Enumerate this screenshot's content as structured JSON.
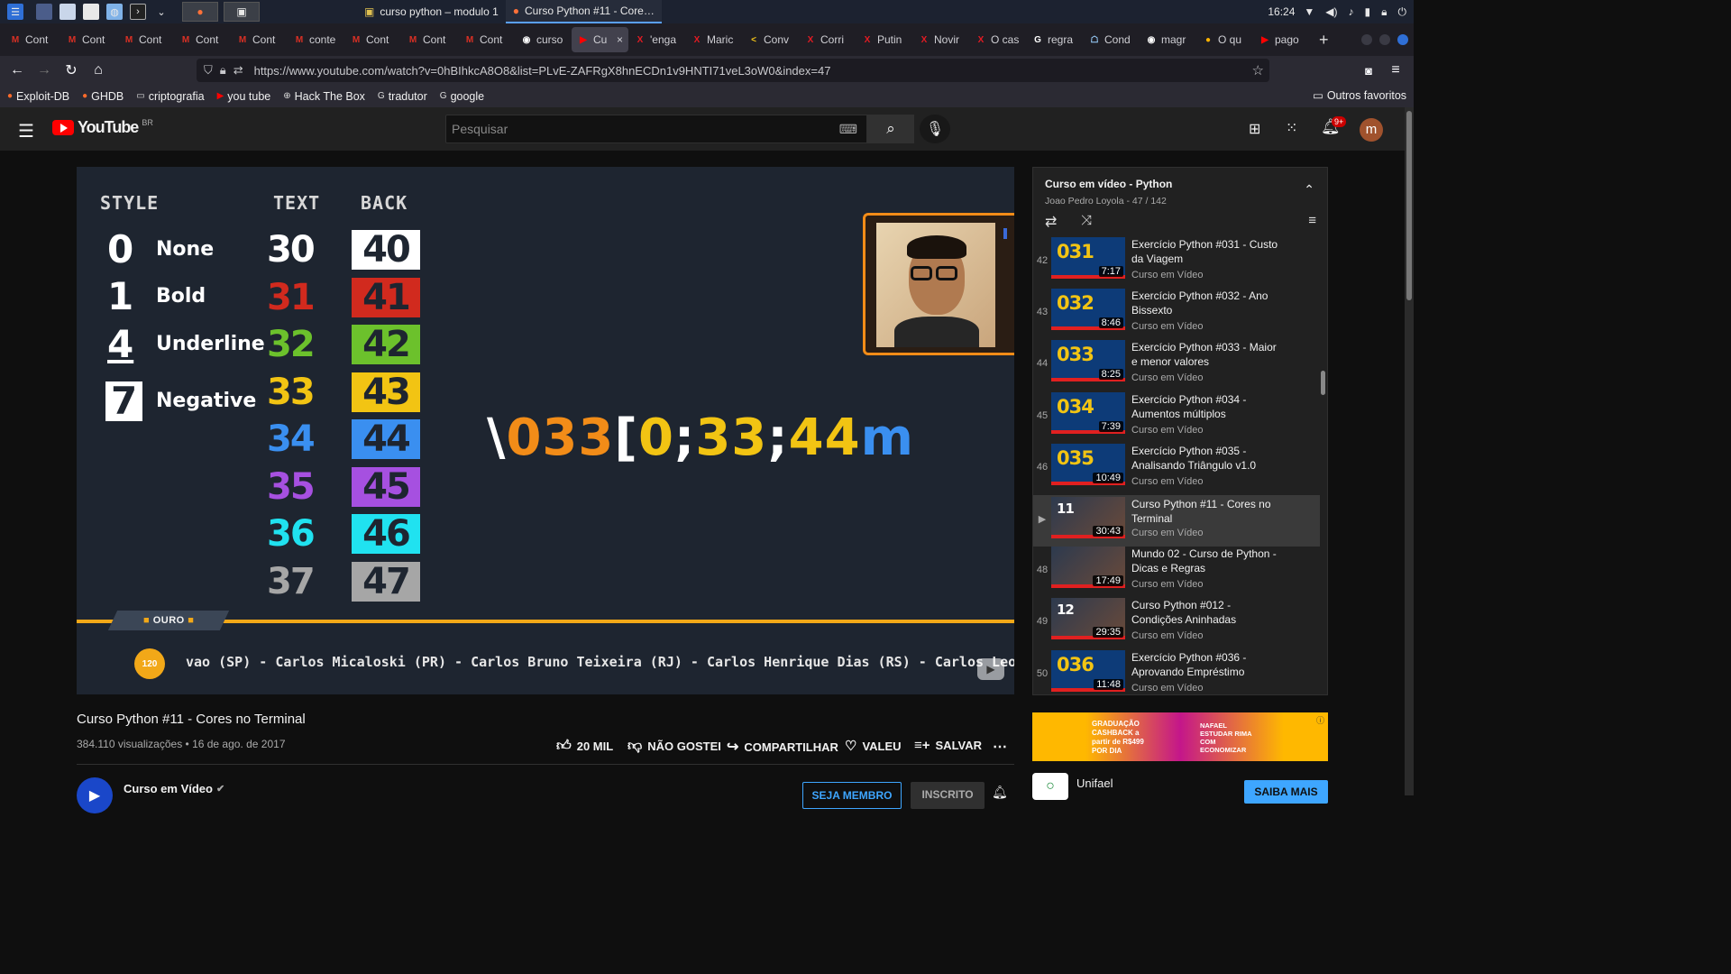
{
  "taskbar": {
    "windows": [
      "curso python – modulo 1",
      "Curso Python #11 - Core…"
    ],
    "time": "16:24"
  },
  "tabs": [
    {
      "label": "Cont",
      "fav": "M",
      "color": "#d93025"
    },
    {
      "label": "Cont",
      "fav": "M",
      "color": "#d93025"
    },
    {
      "label": "Cont",
      "fav": "M",
      "color": "#d93025"
    },
    {
      "label": "Cont",
      "fav": "M",
      "color": "#d93025"
    },
    {
      "label": "Cont",
      "fav": "M",
      "color": "#d93025"
    },
    {
      "label": "conte",
      "fav": "M",
      "color": "#d93025"
    },
    {
      "label": "Cont",
      "fav": "M",
      "color": "#d93025"
    },
    {
      "label": "Cont",
      "fav": "M",
      "color": "#d93025"
    },
    {
      "label": "Cont",
      "fav": "M",
      "color": "#d93025"
    },
    {
      "label": "curso",
      "fav": "◉",
      "color": "#ffffff"
    },
    {
      "label": "Cu",
      "fav": "▶",
      "color": "#ff0000",
      "active": true
    },
    {
      "label": "'enga",
      "fav": "X",
      "color": "#e31b23"
    },
    {
      "label": "Maric",
      "fav": "X",
      "color": "#e31b23"
    },
    {
      "label": "Conv",
      "fav": "<",
      "color": "#f5c518"
    },
    {
      "label": "Corri",
      "fav": "X",
      "color": "#e31b23"
    },
    {
      "label": "Putin",
      "fav": "X",
      "color": "#e31b23"
    },
    {
      "label": "Novir",
      "fav": "X",
      "color": "#e31b23"
    },
    {
      "label": "O cas",
      "fav": "X",
      "color": "#e31b23"
    },
    {
      "label": "regra",
      "fav": "G",
      "color": "#ffffff"
    },
    {
      "label": "Cond",
      "fav": "☖",
      "color": "#9ad0ff"
    },
    {
      "label": "magr",
      "fav": "◉",
      "color": "#ffffff"
    },
    {
      "label": "O qu",
      "fav": "●",
      "color": "#ffb300"
    },
    {
      "label": "pago",
      "fav": "▶",
      "color": "#ff0000"
    }
  ],
  "url": "https://www.youtube.com/watch?v=0hBIhkcA8O8&list=PLvE-ZAFRgX8hnECDn1v9HNTI71veL3oW0&index=47",
  "bookmarks": [
    {
      "label": "Exploit-DB",
      "icon": "●"
    },
    {
      "label": "GHDB",
      "icon": "●"
    },
    {
      "label": "criptografia",
      "icon": "▭"
    },
    {
      "label": "you tube",
      "icon": "▶"
    },
    {
      "label": "Hack The Box",
      "icon": "⊕"
    },
    {
      "label": "tradutor",
      "icon": "G"
    },
    {
      "label": "google",
      "icon": "G"
    }
  ],
  "bookmarks_other": "Outros favoritos",
  "youtube": {
    "logo": "YouTube",
    "region": "BR",
    "search_placeholder": "Pesquisar",
    "notifications": "9+",
    "avatar": "m"
  },
  "video_frame": {
    "headers": {
      "style": "STYLE",
      "text": "TEXT",
      "back": "BACK"
    },
    "styles": [
      {
        "code": "0",
        "label": "None"
      },
      {
        "code": "1",
        "label": "Bold"
      },
      {
        "code": "4",
        "label": "Underline"
      },
      {
        "code": "7",
        "label": "Negative"
      }
    ],
    "text_codes": [
      {
        "code": "30",
        "color": "#ffffff"
      },
      {
        "code": "31",
        "color": "#d12a1e"
      },
      {
        "code": "32",
        "color": "#6cc12c"
      },
      {
        "code": "33",
        "color": "#f2c413"
      },
      {
        "code": "34",
        "color": "#3a8ff0"
      },
      {
        "code": "35",
        "color": "#a650e0"
      },
      {
        "code": "36",
        "color": "#20e2f0"
      },
      {
        "code": "37",
        "color": "#a6a6a6"
      }
    ],
    "back_codes": [
      {
        "code": "40",
        "bg": "#ffffff",
        "fg": "#1e2530"
      },
      {
        "code": "41",
        "bg": "#d12a1e",
        "fg": "#1e2530"
      },
      {
        "code": "42",
        "bg": "#6cc12c",
        "fg": "#1e2530"
      },
      {
        "code": "43",
        "bg": "#f2c413",
        "fg": "#1e2530"
      },
      {
        "code": "44",
        "bg": "#3a8ff0",
        "fg": "#1e2530"
      },
      {
        "code": "45",
        "bg": "#a650e0",
        "fg": "#1e2530"
      },
      {
        "code": "46",
        "bg": "#20e2f0",
        "fg": "#1e2530"
      },
      {
        "code": "47",
        "bg": "#a6a6a6",
        "fg": "#1e2530"
      }
    ],
    "escape_parts": [
      {
        "text": "\\",
        "color": "#ffffff"
      },
      {
        "text": "033",
        "color": "#f28c18"
      },
      {
        "text": "[",
        "color": "#ffffff"
      },
      {
        "text": "0",
        "color": "#f2c413"
      },
      {
        "text": ";",
        "color": "#ffffff"
      },
      {
        "text": "33",
        "color": "#f2c413"
      },
      {
        "text": ";",
        "color": "#ffffff"
      },
      {
        "text": "44",
        "color": "#f2c413"
      },
      {
        "text": "m",
        "color": "#3a8ff0"
      }
    ],
    "badge": "OURO",
    "medal": "120",
    "ticker": "vao (SP) - Carlos Micaloski (PR) - Carlos Bruno Teixeira (RJ) - Carlos Henrique Dias (RS) - Carlos Leon"
  },
  "video": {
    "title": "Curso Python #11 - Cores no Terminal",
    "views": "384.110 visualizações",
    "date": "16 de ago. de 2017",
    "likes": "20 MIL",
    "dislike": "NÃO GOSTEI",
    "share": "COMPARTILHAR",
    "thanks": "VALEU",
    "save": "SALVAR",
    "channel": "Curso em Vídeo",
    "join": "SEJA MEMBRO",
    "subscribed": "INSCRITO"
  },
  "playlist": {
    "title": "Curso em vídeo - Python",
    "meta": "Joao Pedro Loyola - 47 / 142",
    "items": [
      {
        "idx": "42",
        "title": "Exercício Python #031 - Custo da Viagem",
        "channel": "Curso em Vídeo",
        "duration": "7:17",
        "thumb": "031"
      },
      {
        "idx": "43",
        "title": "Exercício Python #032 - Ano Bissexto",
        "channel": "Curso em Vídeo",
        "duration": "8:46",
        "thumb": "032"
      },
      {
        "idx": "44",
        "title": "Exercício Python #033 - Maior e menor valores",
        "channel": "Curso em Vídeo",
        "duration": "8:25",
        "thumb": "033"
      },
      {
        "idx": "45",
        "title": "Exercício Python #034 - Aumentos múltiplos",
        "channel": "Curso em Vídeo",
        "duration": "7:39",
        "thumb": "034"
      },
      {
        "idx": "46",
        "title": "Exercício Python #035 - Analisando Triângulo v1.0",
        "channel": "Curso em Vídeo",
        "duration": "10:49",
        "thumb": "035"
      },
      {
        "idx": "▶",
        "title": "Curso Python #11 - Cores no Terminal",
        "channel": "Curso em Vídeo",
        "duration": "30:43",
        "thumb": "11",
        "active": true
      },
      {
        "idx": "48",
        "title": "Mundo 02 - Curso de Python - Dicas e Regras",
        "channel": "Curso em Vídeo",
        "duration": "17:49",
        "thumb": ""
      },
      {
        "idx": "49",
        "title": "Curso Python #012 - Condições Aninhadas",
        "channel": "Curso em Vídeo",
        "duration": "29:35",
        "thumb": "12"
      },
      {
        "idx": "50",
        "title": "Exercício Python #036 - Aprovando Empréstimo",
        "channel": "Curso em Vídeo",
        "duration": "11:48",
        "thumb": "036"
      }
    ]
  },
  "ad": {
    "banner_text": "GRADUAÇÃO CASHBACK a partir de R$499 POR DIA",
    "banner_side": "NAFAEL ESTUDAR RIMA COM ECONOMIZAR",
    "advertiser": "Unifael",
    "cta": "SAIBA MAIS"
  }
}
